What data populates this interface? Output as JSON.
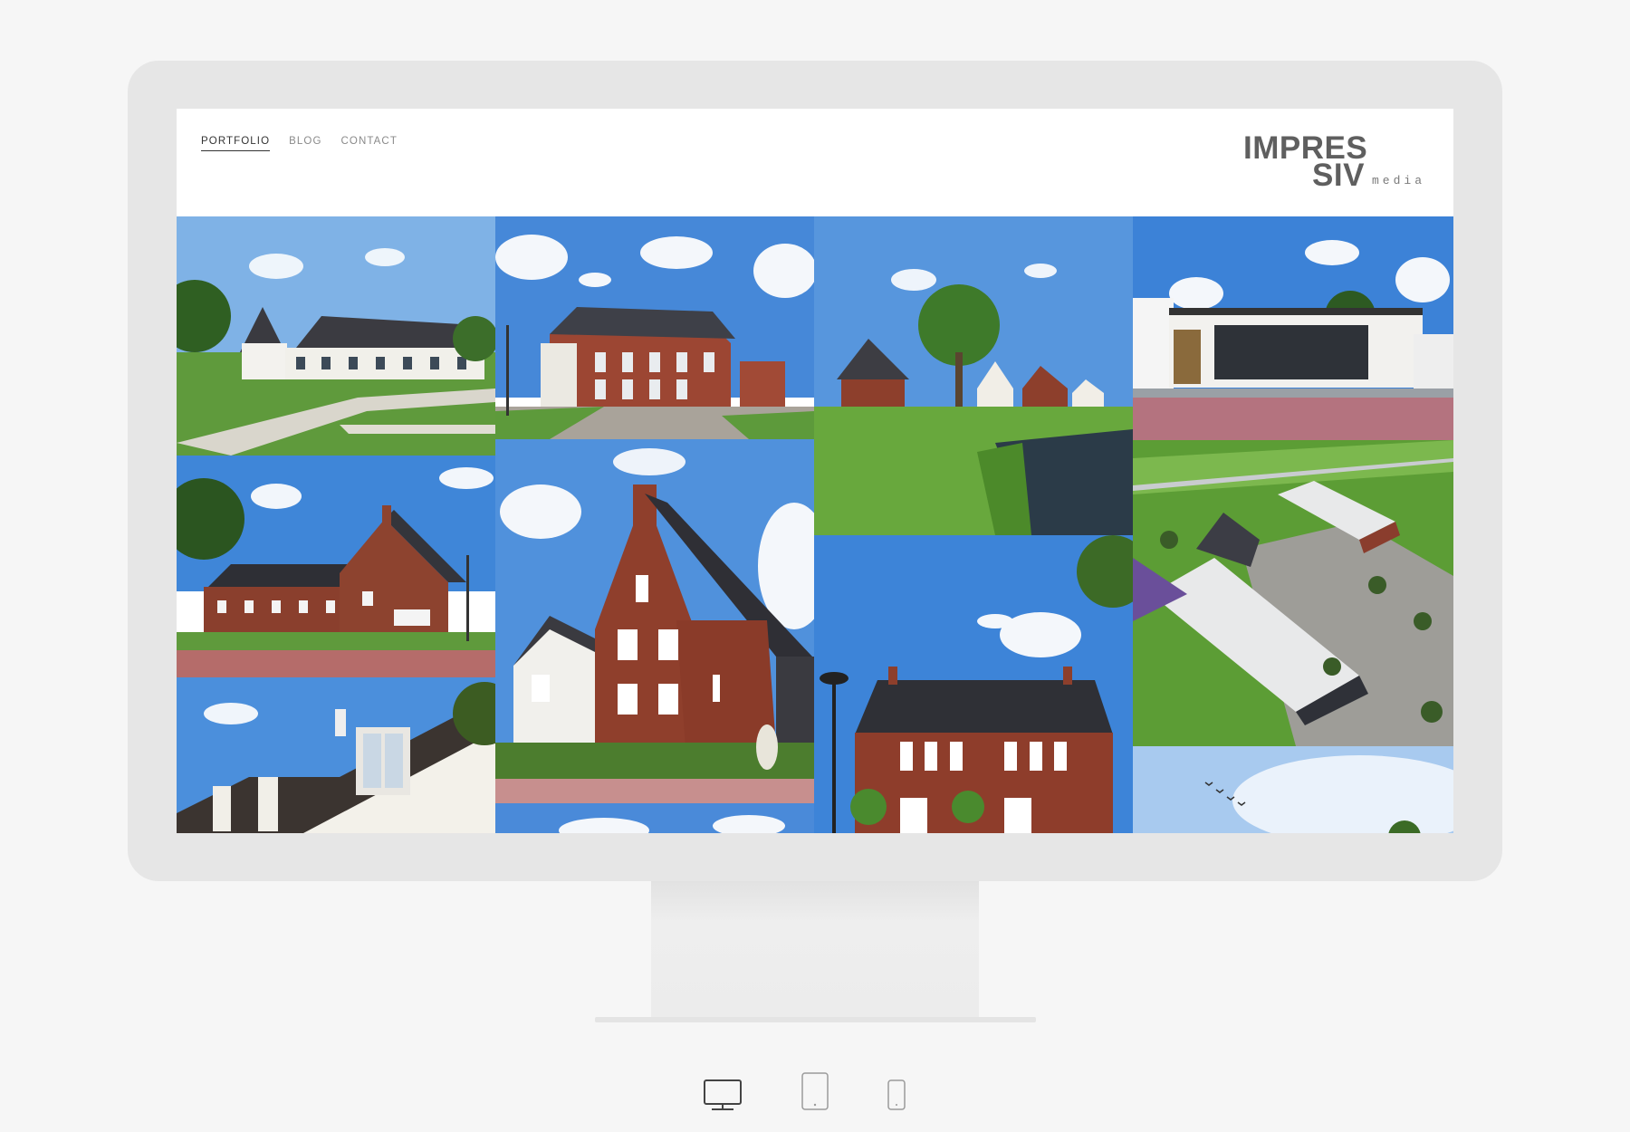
{
  "nav": {
    "items": [
      {
        "label": "PORTFOLIO",
        "active": true
      },
      {
        "label": "BLOG",
        "active": false
      },
      {
        "label": "CONTACT",
        "active": false
      }
    ]
  },
  "logo": {
    "line1": "IMPRES",
    "line2": "SIV",
    "sub": "media"
  },
  "colors": {
    "sky": "#4f8fd9",
    "brick": "#8f3f2c",
    "grass": "#5b9a37",
    "roof": "#3a3a3f"
  },
  "portfolio": {
    "tiles": [
      "row-houses-white",
      "apartment-corner-brick",
      "houses-by-pond",
      "modern-bungalow",
      "brick-terrace-street",
      "brick-gable-house",
      "aerial-farm-complex",
      "dormer-rooftops",
      "brick-villa-lamp",
      "sky-birds",
      "clouds-partial"
    ]
  },
  "device_switcher": [
    "desktop-icon",
    "tablet-icon",
    "phone-icon"
  ]
}
